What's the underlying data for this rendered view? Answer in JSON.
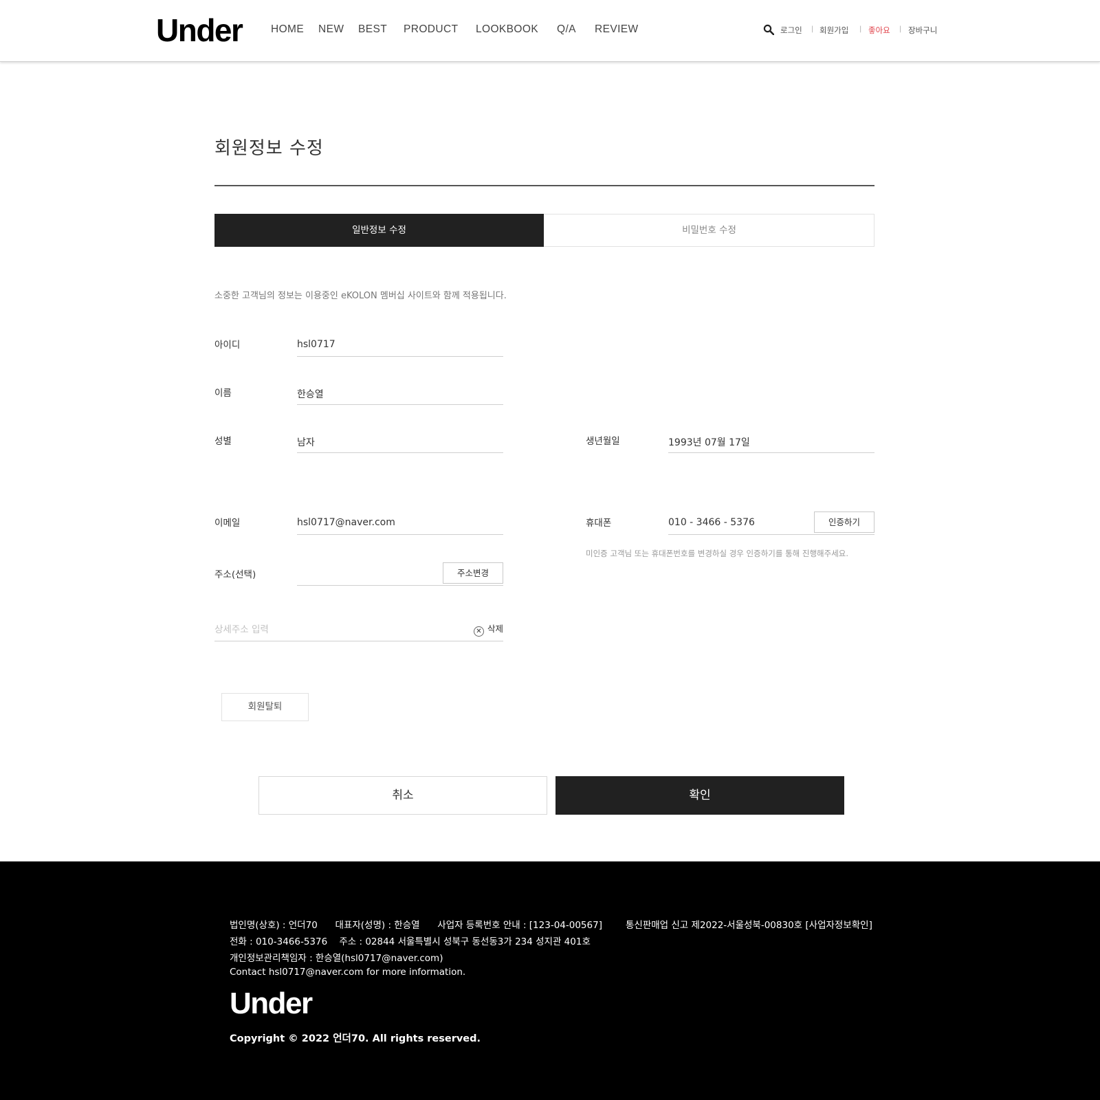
{
  "header": {
    "logo": "Under",
    "nav": [
      "HOME",
      "NEW",
      "BEST",
      "PRODUCT",
      "LOOKBOOK",
      "Q/A",
      "REVIEW"
    ],
    "util": {
      "login": "로그인",
      "signup": "회원가입",
      "like": "좋아요",
      "cart": "장바구니",
      "separator": "|"
    },
    "icons": {
      "search": "search-icon"
    },
    "colors": {
      "like": "#e0424a"
    }
  },
  "page": {
    "title": "회원정보 수정",
    "tabs": {
      "general": "일반정보 수정",
      "password": "비밀번호 수정"
    },
    "intro": "소중한 고객님의 정보는 이용중인 eKOLON 멤버십 사이트와 함께 적용됩니다."
  },
  "form": {
    "id": {
      "label": "아이디",
      "value": "hsl0717"
    },
    "name": {
      "label": "이름",
      "value": "한승열"
    },
    "gender": {
      "label": "성별",
      "value": "남자"
    },
    "birth": {
      "label": "생년월일",
      "value": "1993년 07월 17일"
    },
    "email": {
      "label": "이메일",
      "value": "hsl0717@naver.com"
    },
    "phone": {
      "label": "휴대폰",
      "value": "010 - 3466 - 5376",
      "verify_button": "인증하기",
      "note": "미인증 고객님 또는 휴대폰번호를 변경하실 경우 인증하기를 통해 진행해주세요."
    },
    "address": {
      "label": "주소(선택)",
      "value": "",
      "change_button": "주소변경"
    },
    "detail_address": {
      "placeholder": "상세주소 입력",
      "delete_label": "삭제",
      "delete_icon": "close-circle-icon"
    }
  },
  "actions": {
    "withdraw": "회원탈퇴",
    "cancel": "취소",
    "confirm": "확인",
    "colors": {
      "primary": "#212121"
    }
  },
  "footer": {
    "line1a": "법인명(상호) : 언더70      대표자(성명) : 한승열      사업자 등록번호 안내 : [123-04-00567]",
    "line1b": "통신판매업 신고 제2022-서울성북-00830호 [사업자정보확인]",
    "line2": "전화 : 010-3466-5376    주소 : 02844 서울특별시 성북구 동선동3가 234 성지관 401호",
    "line3": "개인정보관리책임자 : 한승열(hsl0717@naver.com)",
    "line4": "Contact hsl0717@naver.com for more information.",
    "logo": "Under",
    "copyright": "Copyright © 2022 언더70. All rights reserved."
  }
}
